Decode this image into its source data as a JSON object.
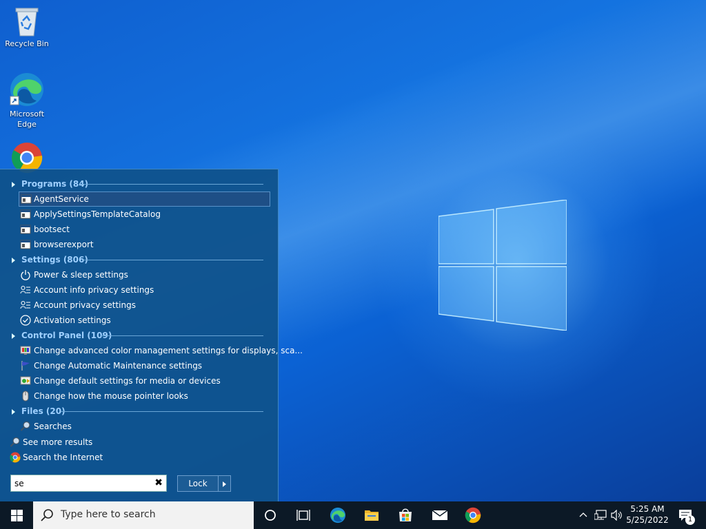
{
  "desktop": {
    "icons": [
      {
        "label": "Recycle Bin",
        "icon": "recycle-bin-icon"
      },
      {
        "label": "Microsoft Edge",
        "icon": "edge-icon"
      },
      {
        "label": "",
        "icon": "chrome-icon"
      }
    ]
  },
  "search_panel": {
    "categories": {
      "programs": "Programs (84)",
      "settings": "Settings (806)",
      "control_panel": "Control Panel (109)",
      "files": "Files (20)"
    },
    "programs": [
      "AgentService",
      "ApplySettingsTemplateCatalog",
      "bootsect",
      "browserexport"
    ],
    "settings": [
      "Power & sleep settings",
      "Account info privacy settings",
      "Account privacy settings",
      "Activation settings"
    ],
    "control_panel": [
      "Change advanced color management settings for displays, sca...",
      "Change Automatic Maintenance settings",
      "Change default settings for media or devices",
      "Change how the mouse pointer looks"
    ],
    "files": [
      "Searches"
    ],
    "see_more": "See more results",
    "search_internet": "Search the Internet",
    "query": "se",
    "lock_label": "Lock"
  },
  "taskbar": {
    "search_placeholder": "Type here to search",
    "time": "5:25 AM",
    "date": "5/25/2022",
    "notification_count": "1"
  },
  "colors": {
    "panel_bg": "#0f528c",
    "category_text": "#9fd0ff",
    "taskbar_bg": "#0c1926",
    "desktop_blue": "#1473e0"
  }
}
